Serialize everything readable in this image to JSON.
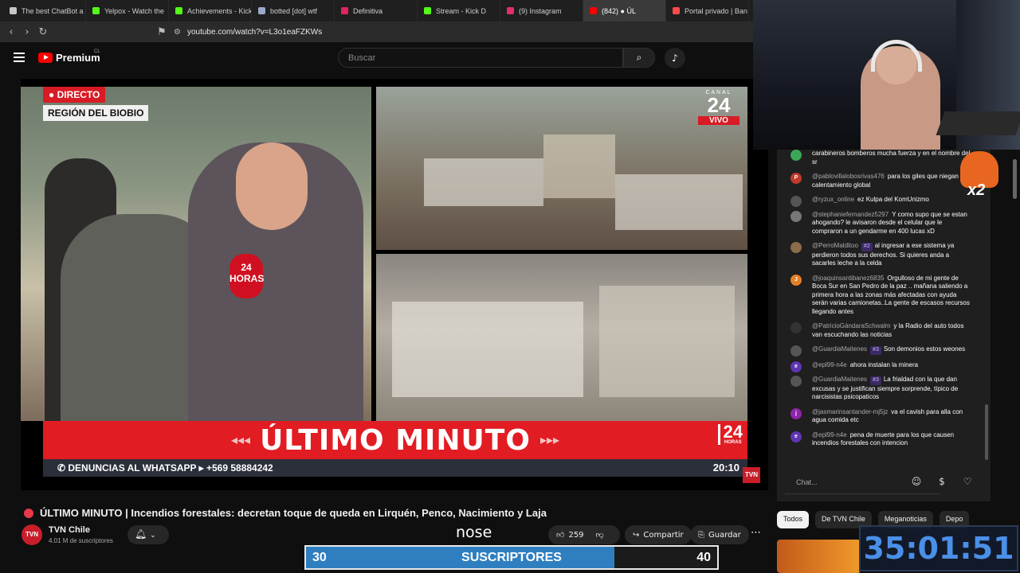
{
  "browser": {
    "tabs": [
      {
        "label": "The best ChatBot a",
        "color": "#c7c7c7"
      },
      {
        "label": "Yelpox - Watch the",
        "color": "#53fc18"
      },
      {
        "label": "Achievements - Kick",
        "color": "#53fc18"
      },
      {
        "label": "botted [dot] wtf",
        "color": "#9aa9c9"
      },
      {
        "label": "Definitiva",
        "color": "#e0245e"
      },
      {
        "label": "Stream - Kick D",
        "color": "#53fc18"
      },
      {
        "label": "(9) Instagram",
        "color": "#e1306c"
      },
      {
        "label": "(842) ● ÚL",
        "color": "#ff0000",
        "active": true
      },
      {
        "label": "Portal privado | Ban",
        "color": "#ff4a4a"
      }
    ],
    "url": "youtube.com/watch?v=L3o1eaFZKWs"
  },
  "youtube": {
    "logo_text": "Premium",
    "region": "CL",
    "search_placeholder": "Buscar"
  },
  "video": {
    "live_badge": "DIRECTO",
    "region_label": "REGIÓN DEL BIOBIO",
    "channel_small": "CANAL",
    "channel_num": "24",
    "vivo": "VIVO",
    "mic_label": "24 HORAS",
    "banner_text": "ÚLTIMO MINUTO",
    "banner_left_arrows": "◂◂◂",
    "banner_right_arrows": "▸▸▸",
    "banner_24": "24",
    "banner_horas": "HORAS",
    "whatsapp_text": "✆ DENUNCIAS AL WHATSAPP ▸ +569 58884242",
    "clock": "20:10",
    "corner_logo": "TVN"
  },
  "info": {
    "title": "ÚLTIMO MINUTO | Incendios forestales: decretan toque de queda en Lirquén, Penco, Nacimiento y Laja",
    "channel_name": "TVN Chile",
    "channel_avatar": "TVN",
    "subscribers": "4.01 M de suscriptores",
    "overlay_text": "nose",
    "likes": "259",
    "share_label": "Compartir",
    "save_label": "Guardar"
  },
  "goal": {
    "current": "30",
    "label": "SUSCRIPTORES",
    "target": "40",
    "progress_fraction": 0.75,
    "bar_color": "#2f7fc0"
  },
  "chat": {
    "messages": [
      {
        "author": "",
        "text": "carabineros bomberos mucha fuerza y en el nombre del sr",
        "avatar": "",
        "color": "#3aa757"
      },
      {
        "author": "@pablovillalobosrivas476",
        "text": "para los giles que niegan el calentamiento global",
        "avatar": "P",
        "color": "#c0392b"
      },
      {
        "author": "@ryzux_online",
        "text": "ez Kulpa del KomUnizmo",
        "avatar": "",
        "color": "#555555"
      },
      {
        "author": "@stephaniefernandez5297",
        "text": "Y como supo que se estan ahogando? le avisaron desde el celular que le compraron a un gendarme en 400 lucas xD",
        "avatar": "",
        "color": "#777777"
      },
      {
        "author": "@PerroMalditoo",
        "badge": "#2",
        "text": "al ingresar a ese sistema ya perdieron todos sus derechos. Si quieres anda a sacarles leche a la celda",
        "avatar": "",
        "color": "#8a6d4a"
      },
      {
        "author": "@joaquinsantibanez6835",
        "text": "Orgulloso de mi gente de Boca Sur en San Pedro de la paz .. mañana saliendo a primera hora a las zonas más afectadas con ayuda serán varias camionetas..La gente de escasos recursos llegando antes",
        "avatar": "J",
        "color": "#e67e22"
      },
      {
        "author": "@PatricioGándaraSchwalm",
        "text": "y la Radio del auto todos van escuchando las noticias",
        "avatar": "",
        "color": "#333333"
      },
      {
        "author": "@GuardiaMaitenes",
        "badge": "#3",
        "text": "Son demonios estos weones",
        "avatar": "",
        "color": "#555555"
      },
      {
        "author": "@epl99-n4e",
        "text": "ahora instalan la minera",
        "avatar": "e",
        "color": "#5e35b1"
      },
      {
        "author": "@GuardiaMaitenes",
        "badge": "#3",
        "text": "La frialdad con la que dan excusas y se justifican siempre sorprende, típico de narcisistas psicopaticos",
        "avatar": "",
        "color": "#555555"
      },
      {
        "author": "@jasmarinsantander-mj5jz",
        "text": "va el cavish para alla con agua comida etc",
        "avatar": "j",
        "color": "#8e24aa"
      },
      {
        "author": "@epl99-n4e",
        "text": "pena de muerte para los que causen incendios forestales con intencion",
        "avatar": "e",
        "color": "#5e35b1"
      }
    ],
    "input_placeholder": "Chat...",
    "chips": [
      "Todos",
      "De TVN Chile",
      "Meganoticias",
      "Depo"
    ]
  },
  "overlay": {
    "timer": "35:01:51",
    "multiplier": "x2"
  }
}
